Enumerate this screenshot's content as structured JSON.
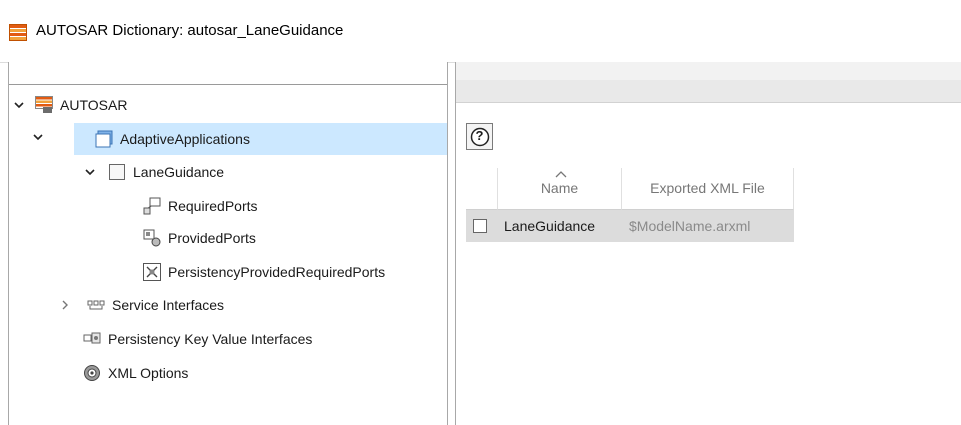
{
  "window": {
    "title": "AUTOSAR Dictionary: autosar_LaneGuidance",
    "icon": "autosar-dictionary-icon"
  },
  "tree": {
    "root": {
      "label": "AUTOSAR",
      "icon": "autosar-root-icon",
      "expanded": true
    },
    "adaptive_applications": {
      "label": "AdaptiveApplications",
      "icon": "adaptive-applications-icon",
      "expanded": true,
      "selected": true
    },
    "lane_guidance": {
      "label": "LaneGuidance",
      "icon": "component-icon",
      "expanded": true
    },
    "required_ports": {
      "label": "RequiredPorts",
      "icon": "required-ports-icon"
    },
    "provided_ports": {
      "label": "ProvidedPorts",
      "icon": "provided-ports-icon"
    },
    "persistency_ports": {
      "label": "PersistencyProvidedRequiredPorts",
      "icon": "persistency-ports-icon"
    },
    "service_interfaces": {
      "label": "Service Interfaces",
      "icon": "service-interfaces-icon",
      "expanded": false
    },
    "persistency_kv_interfaces": {
      "label": "Persistency Key Value Interfaces",
      "icon": "persistency-kv-icon"
    },
    "xml_options": {
      "label": "XML Options",
      "icon": "gear-icon"
    }
  },
  "toolbar": {
    "help_label": "?",
    "help_icon": "help-icon"
  },
  "table": {
    "headers": [
      "Name",
      "Exported XML File"
    ],
    "sort_column": "Name",
    "rows": [
      {
        "name": "LaneGuidance",
        "exported_xml_file": "$ModelName.arxml",
        "selected": false
      }
    ]
  },
  "colors": {
    "selection": "#cce8ff",
    "row_highlight": "#dcdcdc"
  }
}
